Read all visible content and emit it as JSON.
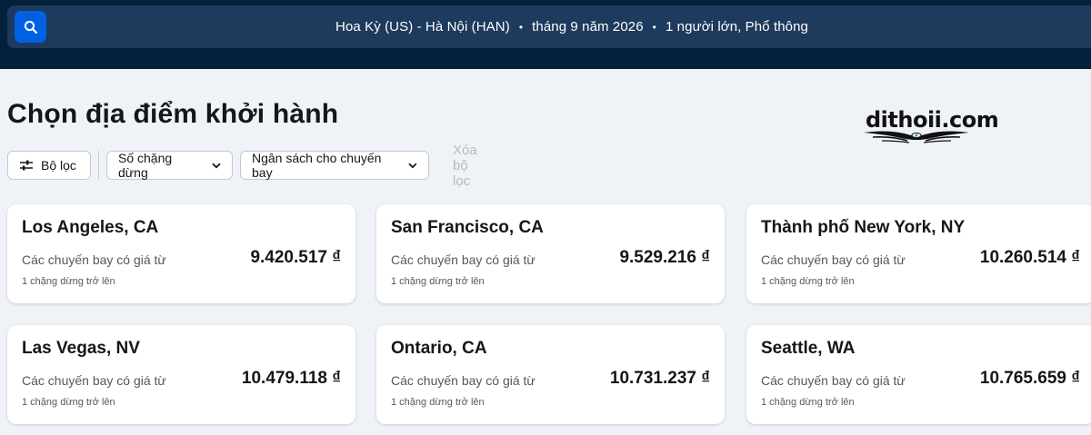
{
  "header": {
    "search_icon": "search-icon",
    "route": "Hoa Kỳ (US) - Hà Nội (HAN)",
    "date": "tháng 9 năm 2026",
    "travellers": "1 người lớn, Phổ thông",
    "separator": "•"
  },
  "page": {
    "title": "Chọn địa điểm khởi hành",
    "logo_text": "dithoii.com"
  },
  "filters": {
    "filter_label": "Bộ lọc",
    "stops_label": "Số chặng dừng",
    "budget_label": "Ngân sách cho chuyến bay",
    "clear_label": "Xóa bộ lọc"
  },
  "cards": [
    {
      "city": "Los Angeles, CA",
      "from_label": "Các chuyến bay có giá từ",
      "price": "9.420.517 ₫",
      "stops": "1 chặng dừng trở lên"
    },
    {
      "city": "San Francisco, CA",
      "from_label": "Các chuyến bay có giá từ",
      "price": "9.529.216 ₫",
      "stops": "1 chặng dừng trở lên"
    },
    {
      "city": "Thành phố New York, NY",
      "from_label": "Các chuyến bay có giá từ",
      "price": "10.260.514 ₫",
      "stops": "1 chặng dừng trở lên"
    },
    {
      "city": "Las Vegas, NV",
      "from_label": "Các chuyến bay có giá từ",
      "price": "10.479.118 ₫",
      "stops": "1 chặng dừng trở lên"
    },
    {
      "city": "Ontario, CA",
      "from_label": "Các chuyến bay có giá từ",
      "price": "10.731.237 ₫",
      "stops": "1 chặng dừng trở lên"
    },
    {
      "city": "Seattle, WA",
      "from_label": "Các chuyến bay có giá từ",
      "price": "10.765.659 ₫",
      "stops": "1 chặng dừng trở lên"
    }
  ],
  "colors": {
    "header_bg": "#05203c",
    "search_strip": "#1e3a5c",
    "accent": "#0062e3",
    "page_bg": "#eff3f8"
  }
}
